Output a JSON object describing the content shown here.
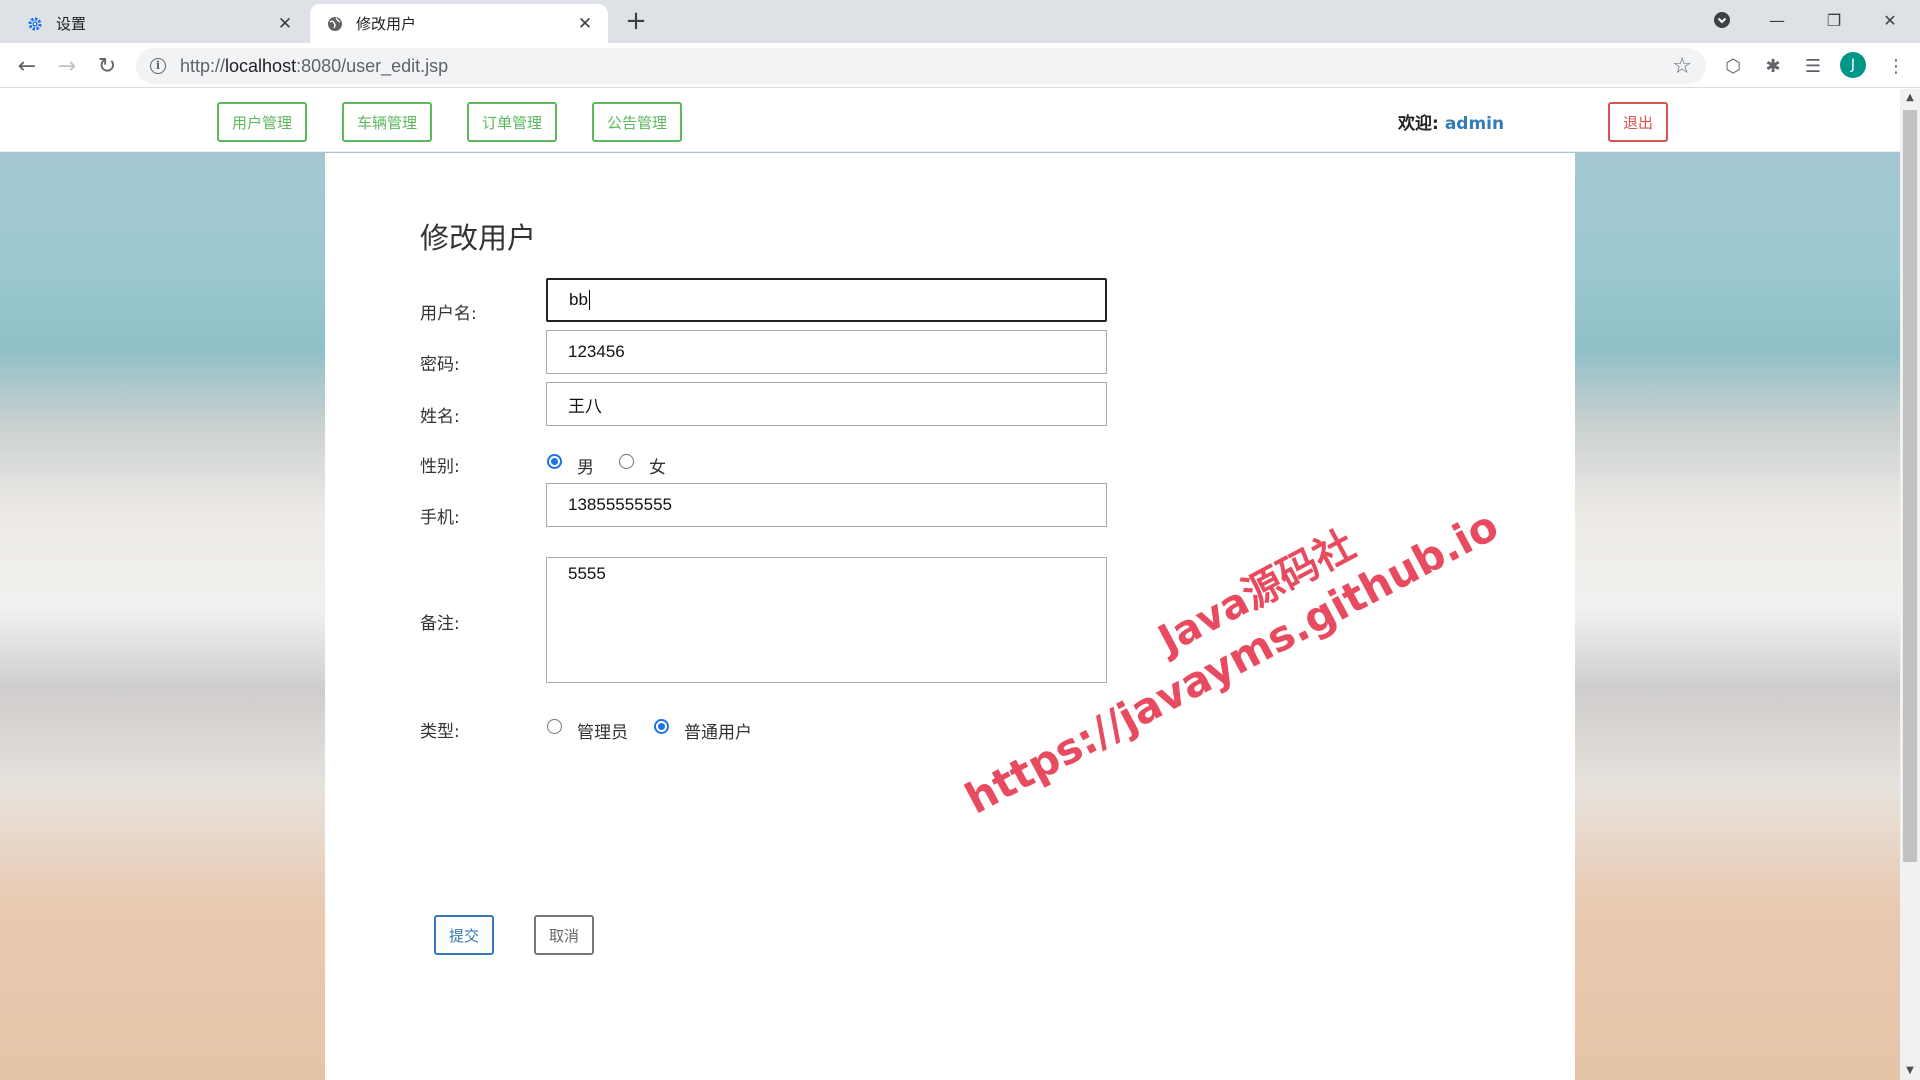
{
  "browser": {
    "tabs": [
      {
        "title": "设置",
        "icon": "gear-icon"
      },
      {
        "title": "修改用户",
        "icon": "globe-icon"
      }
    ],
    "url_prefix": "http://",
    "url_host": "localhost",
    "url_rest": ":8080/user_edit.jsp",
    "profile_initial": "J"
  },
  "nav": {
    "items": [
      "用户管理",
      "车辆管理",
      "订单管理",
      "公告管理"
    ],
    "welcome_label": "欢迎:",
    "username": "admin",
    "logout": "退出"
  },
  "form": {
    "title": "修改用户",
    "username_label": "用户名:",
    "username_value": "bb",
    "password_label": "密码:",
    "password_value": "123456",
    "name_label": "姓名:",
    "name_value": "王八",
    "gender_label": "性别:",
    "gender_options": [
      "男",
      "女"
    ],
    "gender_selected": "男",
    "phone_label": "手机:",
    "phone_value": "13855555555",
    "remark_label": "备注:",
    "remark_value": "5555",
    "type_label": "类型:",
    "type_options": [
      "管理员",
      "普通用户"
    ],
    "type_selected": "普通用户",
    "submit": "提交",
    "cancel": "取消"
  },
  "watermark": {
    "line1": "Java源码社",
    "line2": "https://javayms.github.io"
  },
  "colors": {
    "nav_green": "#5cb85c",
    "logout_red": "#d9534f",
    "primary_blue": "#337ab7",
    "watermark_red": "#e84a5f"
  }
}
